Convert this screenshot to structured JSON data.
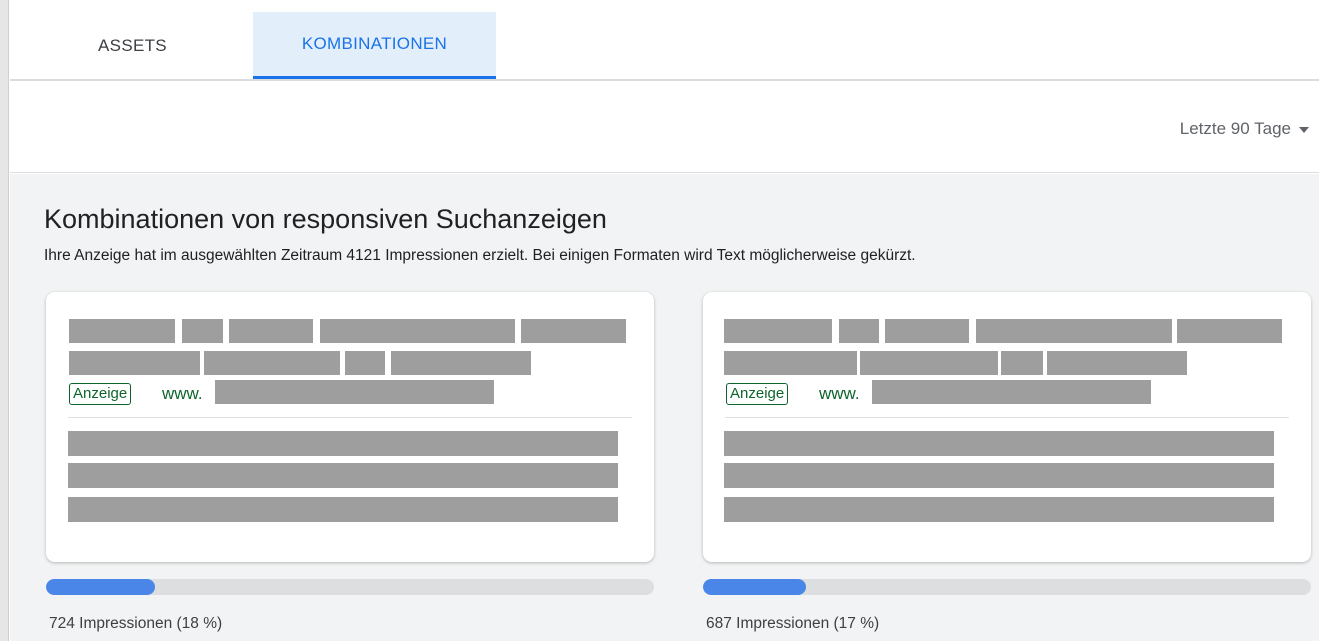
{
  "tabs": [
    {
      "label": "ASSETS",
      "active": false
    },
    {
      "label": "KOMBINATIONEN",
      "active": true
    }
  ],
  "toolbar": {
    "date_range": "Letzte 90 Tage"
  },
  "section": {
    "title": "Kombinationen von responsiven Suchanzeigen",
    "subtitle": "Ihre Anzeige hat im ausgewählten Zeitraum 4121 Impressionen erzielt. Bei einigen Formaten wird Text möglicherweise gekürzt."
  },
  "cards": [
    {
      "badge": "Anzeige",
      "url_prefix": "www.",
      "impressions_label": "724 Impressionen (18 %)",
      "share_percent": 18
    },
    {
      "badge": "Anzeige",
      "url_prefix": "www.",
      "impressions_label": "687 Impressionen (17 %)",
      "share_percent": 17
    }
  ],
  "colors": {
    "accent": "#1a73e8",
    "ad_green": "#0d652d",
    "progress_fill": "#4a86e8"
  }
}
